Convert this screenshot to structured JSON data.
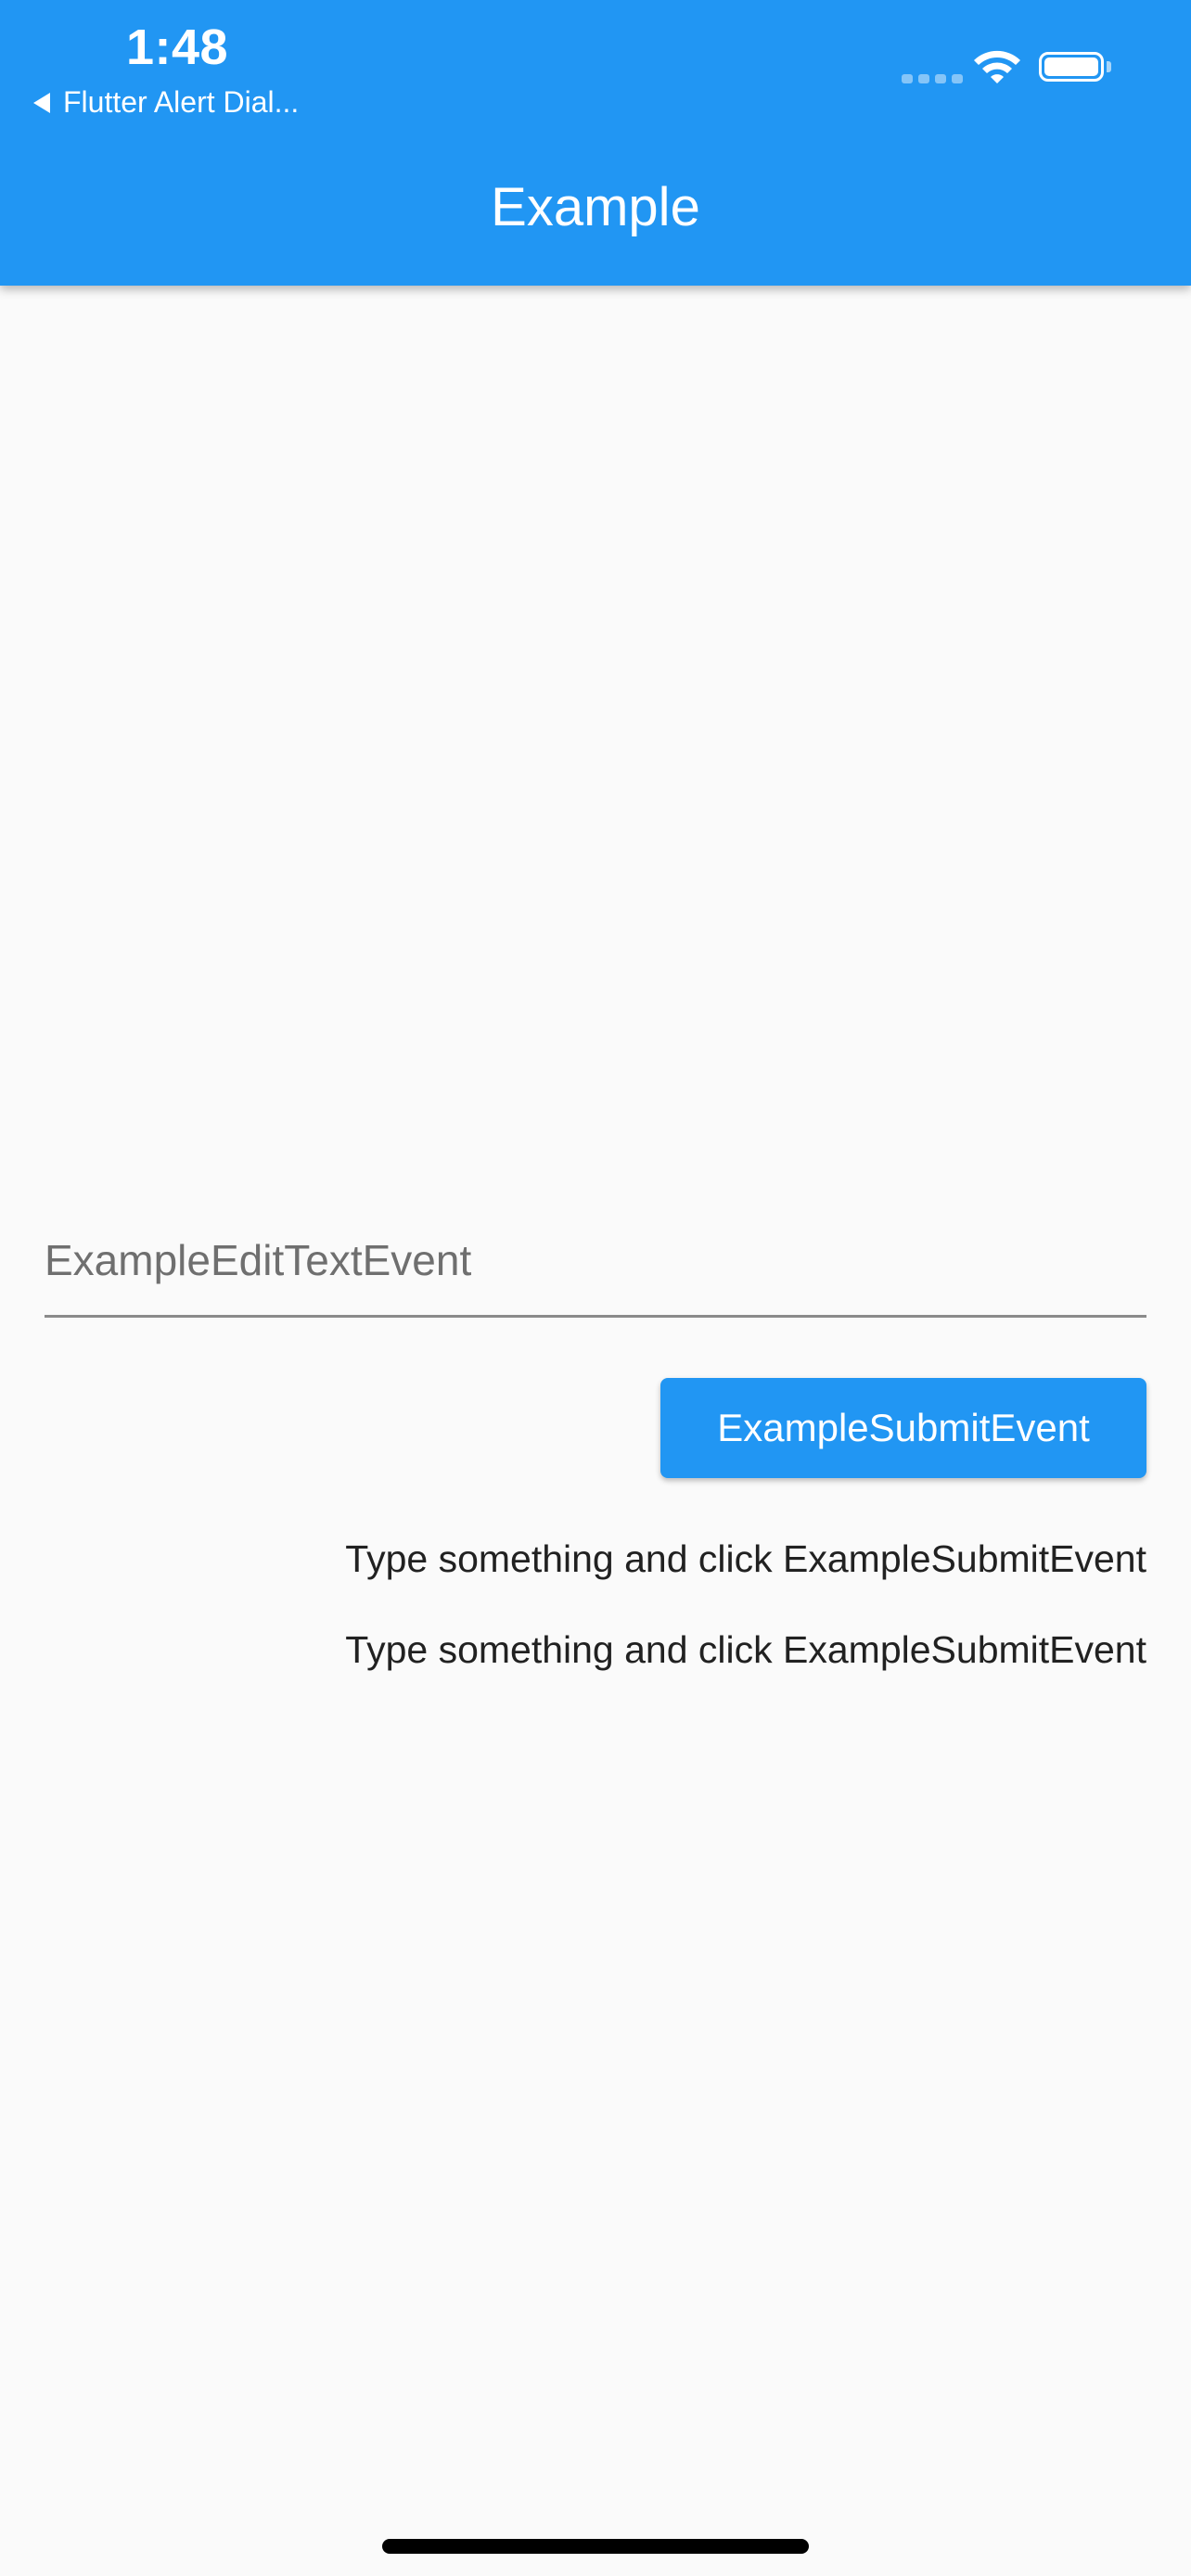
{
  "status_bar": {
    "time": "1:48",
    "back_app_label": "Flutter Alert Dial...",
    "icons": [
      "cellular-signal-icon",
      "wifi-icon",
      "battery-icon"
    ]
  },
  "app_bar": {
    "title": "Example",
    "color": "#2196f3"
  },
  "form": {
    "text_field": {
      "placeholder": "ExampleEditTextEvent",
      "value": ""
    },
    "submit_button_label": "ExampleSubmitEvent"
  },
  "messages": [
    "Type something and click ExampleSubmitEvent",
    "Type something and click ExampleSubmitEvent"
  ],
  "colors": {
    "accent": "#2196f3",
    "background": "#fafafa",
    "text": "#212121"
  }
}
